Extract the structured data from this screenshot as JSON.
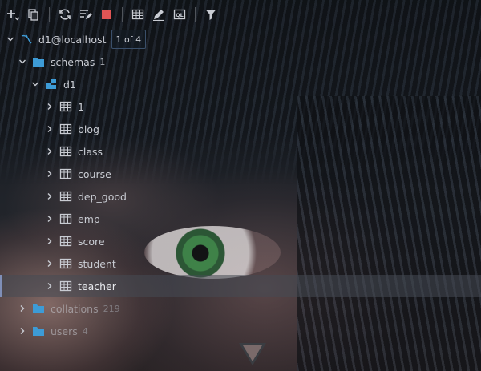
{
  "toolbar": {
    "items": [
      {
        "name": "add-icon"
      },
      {
        "name": "copy-icon"
      },
      {
        "name": "refresh-icon"
      },
      {
        "name": "edit-schema-icon"
      },
      {
        "name": "stop-icon",
        "color": "#e05555"
      },
      {
        "name": "table-view-icon"
      },
      {
        "name": "pencil-icon"
      },
      {
        "name": "sql-console-icon",
        "text": "QL"
      },
      {
        "name": "filter-icon"
      }
    ]
  },
  "tree": {
    "connection": {
      "label": "d1@localhost",
      "pager": "1 of 4"
    },
    "schemas": {
      "label": "schemas",
      "count": "1"
    },
    "database": {
      "label": "d1"
    },
    "tables": [
      "1",
      "blog",
      "class",
      "course",
      "dep_good",
      "emp",
      "score",
      "student",
      "teacher"
    ],
    "selected_table": "teacher",
    "collations": {
      "label": "collations",
      "count": "219"
    },
    "users": {
      "label": "users",
      "count": "4"
    }
  },
  "colors": {
    "folder": "#3d9bd6",
    "accent": "#7f8fb8",
    "stop": "#e05555"
  }
}
